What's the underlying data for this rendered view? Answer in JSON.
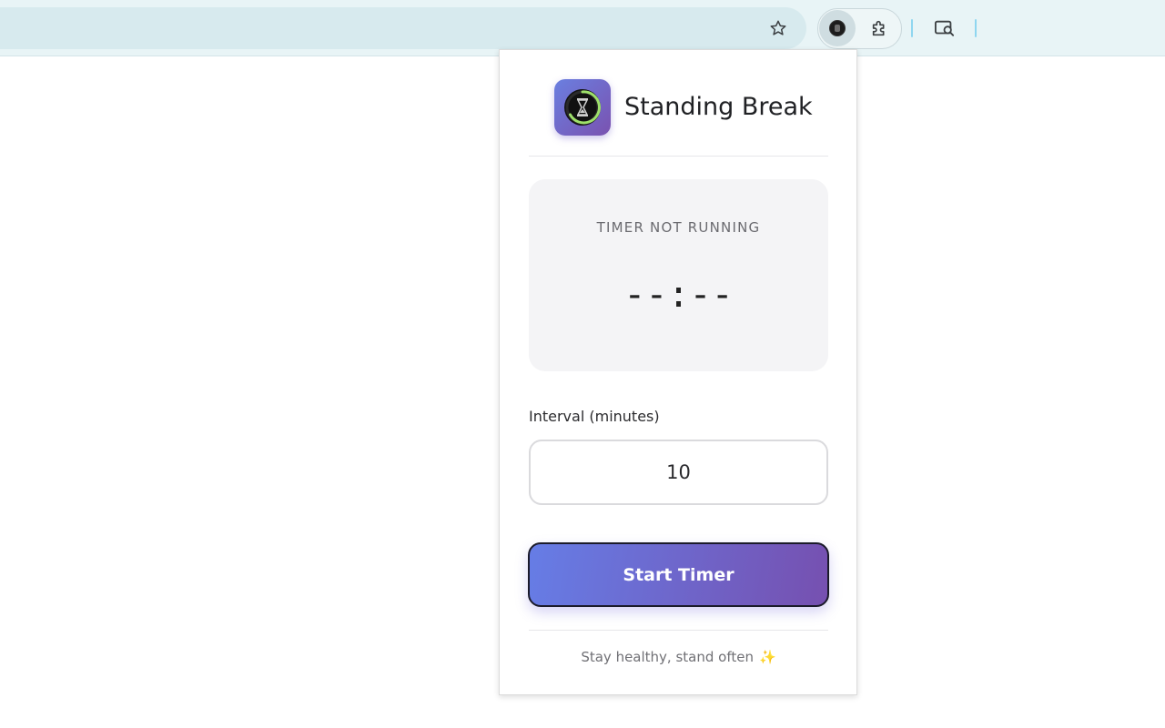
{
  "browser": {
    "icons": {
      "bookmark": "star-icon",
      "extension": "standing-break-extension-icon",
      "extensions_menu": "puzzle-icon",
      "lens": "lens-search-icon"
    }
  },
  "popup": {
    "title": "Standing Break",
    "status_label": "TIMER NOT RUNNING",
    "time_display": "--:--",
    "interval": {
      "label": "Interval (minutes)",
      "value": "10"
    },
    "start_button_label": "Start Timer",
    "footer_text": "Stay healthy, stand often",
    "footer_emoji": "✨"
  },
  "colors": {
    "accent_start": "#667de6",
    "accent_end": "#7650b0",
    "ring": "#9ee06a"
  }
}
